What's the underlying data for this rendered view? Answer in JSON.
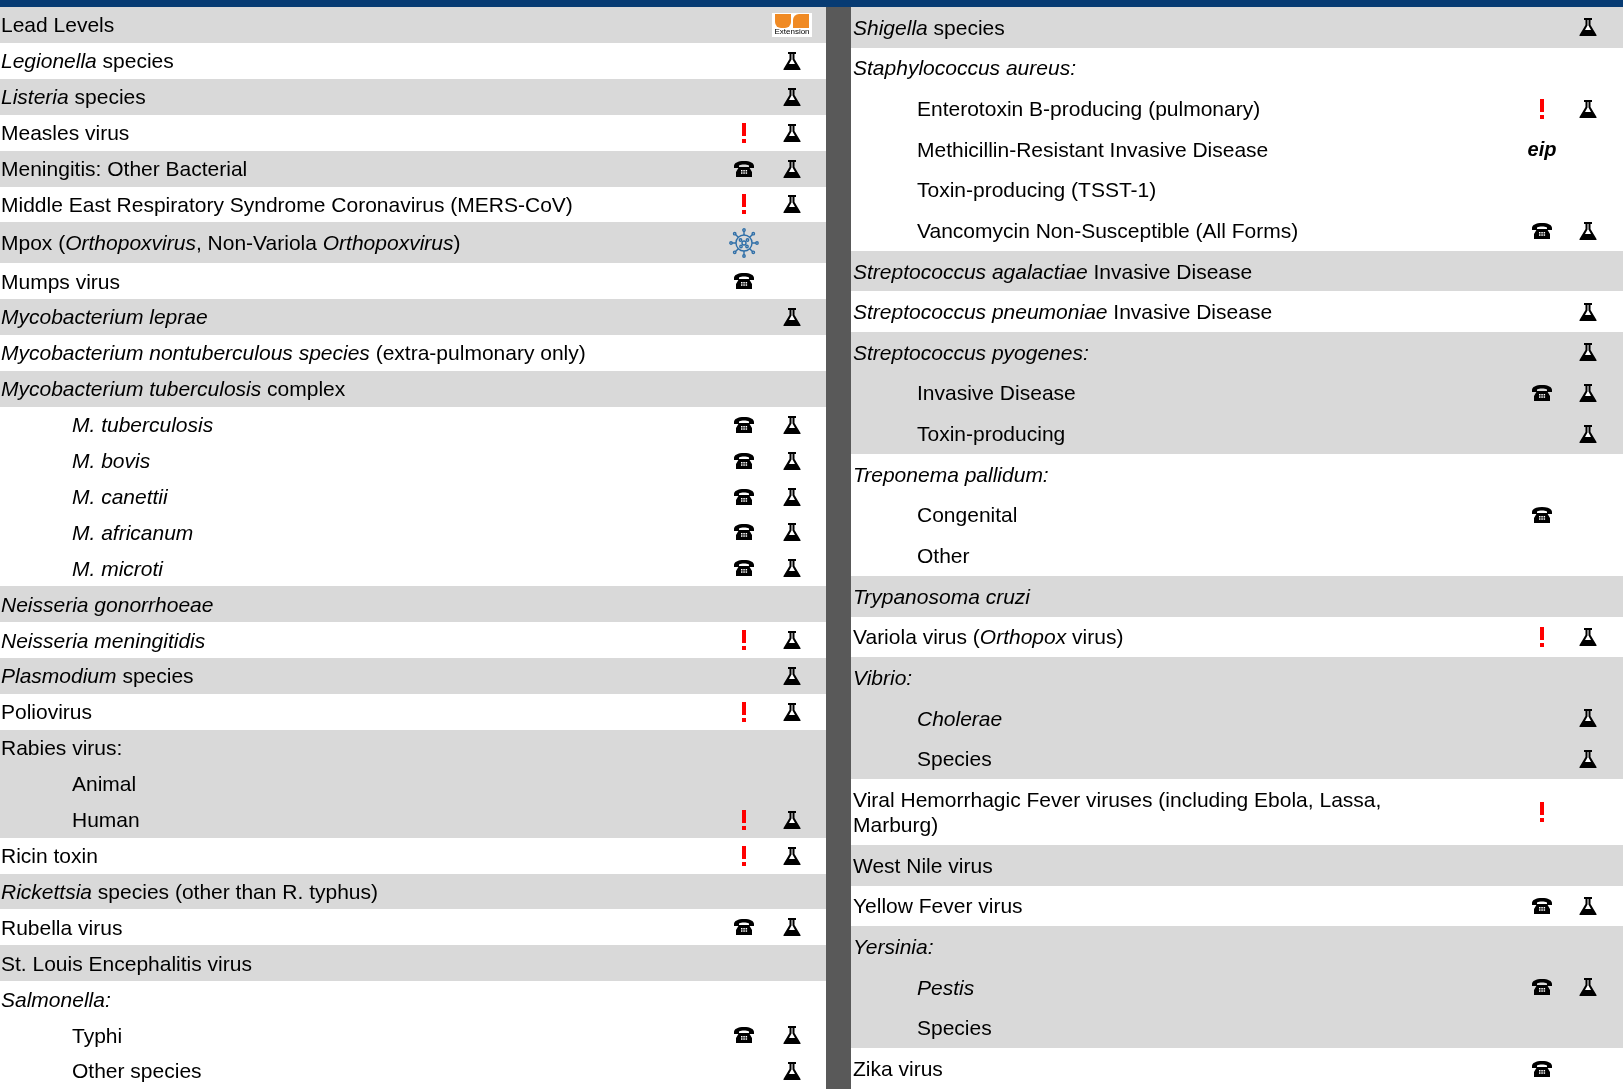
{
  "columns": [
    {
      "rows": [
        {
          "text": "Lead Levels",
          "shaded": true,
          "logo": {
            "text": "Extension"
          }
        },
        {
          "text": "*Legionella* species",
          "shaded": false,
          "lab": true
        },
        {
          "text": "*Listeria* species",
          "shaded": true,
          "lab": true
        },
        {
          "text": "Measles virus",
          "shaded": false,
          "urgent": true,
          "lab": true
        },
        {
          "text": "Meningitis: Other Bacterial",
          "shaded": true,
          "phone": true,
          "lab": true
        },
        {
          "text": "Middle East Respiratory Syndrome Coronavirus (MERS-CoV)",
          "shaded": false,
          "urgent": true,
          "lab": true
        },
        {
          "text": "Mpox  (*Orthopoxvirus*, Non-Variola *Orthopoxvirus*)",
          "shaded": true,
          "virus": true
        },
        {
          "text": "Mumps virus",
          "shaded": false,
          "phone": true
        },
        {
          "text": "Mycobacterium leprae",
          "italic": true,
          "shaded": true,
          "lab": true
        },
        {
          "text": "*Mycobacterium nontuberculous species* (extra-pulmonary only)",
          "shaded": false
        },
        {
          "text": "*Mycobacterium tuberculosis* complex",
          "shaded": true,
          "children": [
            {
              "text": "M. tuberculosis",
              "italic": true,
              "shaded": false,
              "phone": true,
              "lab": true
            },
            {
              "text": "M. bovis",
              "italic": true,
              "shaded": false,
              "phone": true,
              "lab": true
            },
            {
              "text": "M. canettii",
              "italic": true,
              "shaded": false,
              "phone": true,
              "lab": true
            },
            {
              "text": "M. africanum",
              "italic": true,
              "shaded": false,
              "phone": true,
              "lab": true
            },
            {
              "text": "M. microti",
              "italic": true,
              "shaded": false,
              "phone": true,
              "lab": true
            }
          ]
        },
        {
          "text": "Neisseria gonorrhoeae",
          "italic": true,
          "shaded": true
        },
        {
          "text": "Neisseria meningitidis",
          "italic": true,
          "shaded": false,
          "urgent": true,
          "lab": true
        },
        {
          "text": "*Plasmodium* species",
          "shaded": true,
          "lab": true
        },
        {
          "text": "Poliovirus",
          "shaded": false,
          "urgent": true,
          "lab": true
        },
        {
          "text": "Rabies virus:",
          "shaded": true,
          "children": [
            {
              "text": "Animal",
              "shaded": true
            },
            {
              "text": "Human",
              "shaded": true,
              "urgent": true,
              "lab": true
            }
          ]
        },
        {
          "text": "Ricin toxin",
          "shaded": false,
          "urgent": true,
          "lab": true
        },
        {
          "text": "*Rickettsia* species  (other than R. typhus)",
          "shaded": true
        },
        {
          "text": "Rubella virus",
          "shaded": false,
          "phone": true,
          "lab": true
        },
        {
          "text": "St. Louis Encephalitis virus",
          "shaded": true
        },
        {
          "text": "Salmonella:",
          "italic": true,
          "shaded": false,
          "children": [
            {
              "text": "Typhi",
              "shaded": false,
              "phone": true,
              "lab": true
            },
            {
              "text": "Other species",
              "shaded": false,
              "lab": true
            }
          ]
        }
      ]
    },
    {
      "rows": [
        {
          "text": "*Shigella* species",
          "shaded": true,
          "lab": true
        },
        {
          "text": "Staphylococcus aureus:",
          "italic": true,
          "shaded": false,
          "children": [
            {
              "text": "Enterotoxin B-producing  (pulmonary)",
              "shaded": false,
              "urgent": true,
              "lab": true
            },
            {
              "text": "Methicillin-Resistant Invasive Disease",
              "shaded": false,
              "note": "eip"
            },
            {
              "text": "Toxin-producing (TSST-1)",
              "shaded": false
            },
            {
              "text": "Vancomycin Non-Susceptible (All Forms)",
              "shaded": false,
              "phone": true,
              "lab": true
            }
          ]
        },
        {
          "text": "*Streptococcus agalactiae* Invasive Disease",
          "shaded": true
        },
        {
          "text": "*Streptococcus pneumoniae* Invasive Disease",
          "shaded": false,
          "lab": true
        },
        {
          "text": "Streptococcus pyogenes:",
          "italic": true,
          "shaded": true,
          "lab": true,
          "children": [
            {
              "text": "Invasive Disease",
              "shaded": true,
              "phone": true,
              "lab": true
            },
            {
              "text": "Toxin-producing",
              "shaded": true,
              "lab": true
            }
          ]
        },
        {
          "text": "Treponema pallidum:",
          "italic": true,
          "shaded": false,
          "children": [
            {
              "text": "Congenital",
              "shaded": false,
              "phone": true
            },
            {
              "text": "Other",
              "shaded": false
            }
          ]
        },
        {
          "text": "Trypanosoma cruzi",
          "italic": true,
          "shaded": true
        },
        {
          "text": "Variola virus (*Orthopox* virus)",
          "shaded": false,
          "urgent": true,
          "lab": true
        },
        {
          "text": "Vibrio:",
          "italic": true,
          "shaded": true,
          "children": [
            {
              "text": "Cholerae",
              "italic": true,
              "shaded": true,
              "lab": true
            },
            {
              "text": "Species",
              "shaded": true,
              "lab": true
            }
          ]
        },
        {
          "text": "Viral Hemorrhagic Fever viruses (including Ebola, Lassa, Marburg)",
          "shaded": false,
          "urgent": true
        },
        {
          "text": "West Nile virus",
          "shaded": true
        },
        {
          "text": "Yellow Fever virus",
          "shaded": false,
          "phone": true,
          "lab": true
        },
        {
          "text": "Yersinia:",
          "italic": true,
          "shaded": true,
          "children": [
            {
              "text": "Pestis",
              "italic": true,
              "shaded": true,
              "phone": true,
              "lab": true
            },
            {
              "text": "Species",
              "shaded": true
            }
          ]
        },
        {
          "text": "Zika virus",
          "shaded": false,
          "phone": true
        }
      ]
    }
  ]
}
